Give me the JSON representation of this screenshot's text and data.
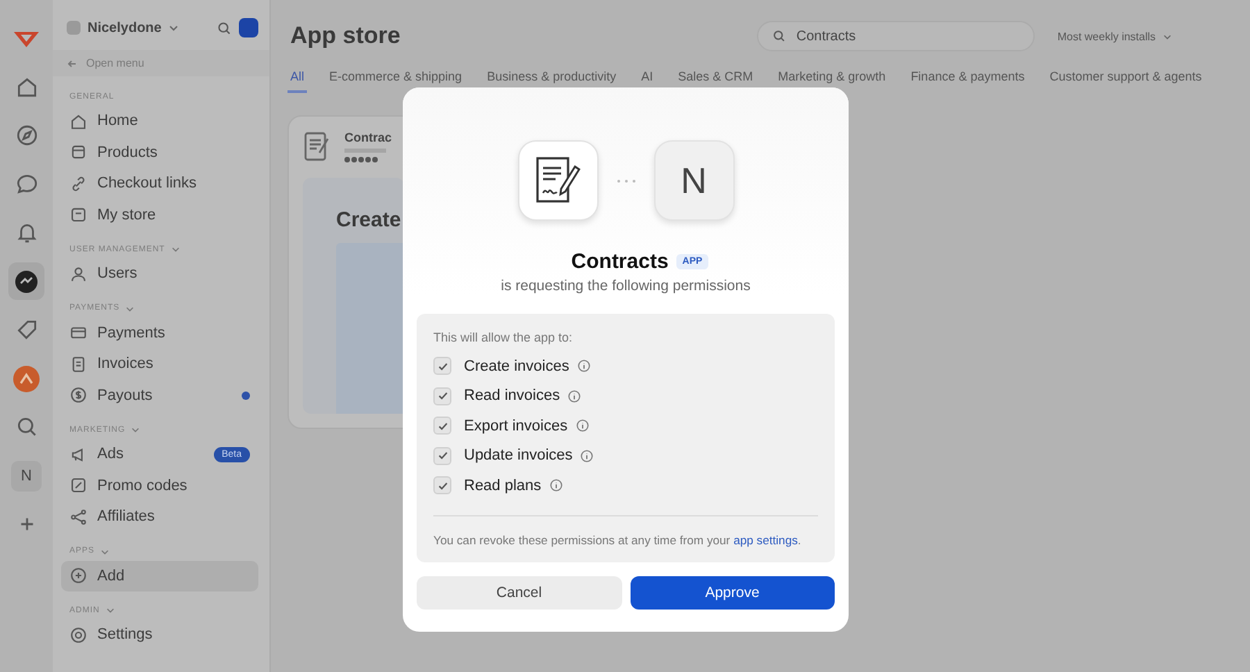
{
  "rail": {
    "items": [
      {
        "kind": "logo",
        "selected": false
      },
      {
        "kind": "home",
        "selected": false
      },
      {
        "kind": "compass",
        "selected": false
      },
      {
        "kind": "chat",
        "selected": false
      },
      {
        "kind": "bell",
        "selected": false
      },
      {
        "kind": "app",
        "selected": true
      },
      {
        "kind": "tag",
        "selected": false
      },
      {
        "kind": "orange",
        "selected": false
      },
      {
        "kind": "search",
        "selected": false
      },
      {
        "kind": "initial",
        "label": "N",
        "selected": false
      },
      {
        "kind": "add",
        "selected": false
      }
    ]
  },
  "sidebar": {
    "workspace": "Nicelydone",
    "open_menu": "Open menu",
    "sections": [
      {
        "title": "GENERAL",
        "items": [
          {
            "label": "Home",
            "kind": "home",
            "selected": false,
            "notification": false
          },
          {
            "label": "Products",
            "kind": "box",
            "selected": false,
            "notification": false
          },
          {
            "label": "Checkout links",
            "kind": "link",
            "selected": false,
            "notification": false
          },
          {
            "label": "My store",
            "kind": "store",
            "selected": false,
            "notification": false
          }
        ]
      },
      {
        "title": "USER MANAGEMENT",
        "expanded": true,
        "items": [
          {
            "label": "Users",
            "kind": "user",
            "selected": false,
            "notification": false
          }
        ]
      },
      {
        "title": "PAYMENTS",
        "expanded": true,
        "items": [
          {
            "label": "Payments",
            "kind": "card",
            "selected": false,
            "notification": false
          },
          {
            "label": "Invoices",
            "kind": "doc",
            "selected": false,
            "notification": false
          },
          {
            "label": "Payouts",
            "kind": "dollar",
            "selected": false,
            "notification": true
          }
        ]
      },
      {
        "title": "MARKETING",
        "expanded": true,
        "items": [
          {
            "label": "Ads",
            "kind": "megaphone",
            "selected": false,
            "notification": false,
            "badge": "Beta"
          },
          {
            "label": "Promo codes",
            "kind": "promo",
            "selected": false,
            "notification": false
          },
          {
            "label": "Affiliates",
            "kind": "share",
            "selected": false,
            "notification": false
          }
        ]
      },
      {
        "title": "APPS",
        "expanded": true,
        "items": [
          {
            "label": "Add",
            "kind": "plus",
            "selected": true,
            "notification": false
          }
        ]
      },
      {
        "title": "ADMIN",
        "expanded": true,
        "items": [
          {
            "label": "Settings",
            "kind": "gear",
            "selected": false,
            "notification": false
          }
        ]
      }
    ]
  },
  "main": {
    "title": "App store",
    "search": {
      "value": "Contracts"
    },
    "sort": "Most weekly installs",
    "tabs": [
      {
        "label": "All",
        "selected": true
      },
      {
        "label": "E-commerce & shipping",
        "selected": false
      },
      {
        "label": "Business & productivity",
        "selected": false
      },
      {
        "label": "AI",
        "selected": false
      },
      {
        "label": "Sales & CRM",
        "selected": false
      },
      {
        "label": "Marketing & growth",
        "selected": false
      },
      {
        "label": "Finance & payments",
        "selected": false
      },
      {
        "label": "Customer support & agents",
        "selected": false
      }
    ],
    "card": {
      "title": "Contrac",
      "stars": 5,
      "heading": "Create"
    }
  },
  "dialog": {
    "app_initial": "N",
    "title": "Contracts",
    "badge": "APP",
    "subtitle": "is requesting the following permissions",
    "intro": "This will allow the app to:",
    "permissions": [
      {
        "label": "Create invoices",
        "checked": true
      },
      {
        "label": "Read invoices",
        "checked": true
      },
      {
        "label": "Export invoices",
        "checked": true
      },
      {
        "label": "Update invoices",
        "checked": true
      },
      {
        "label": "Read plans",
        "checked": true
      }
    ],
    "note": "You can revoke these permissions at any time from your",
    "note_link": "app settings",
    "note_end": ".",
    "buttons": [
      {
        "label": "Cancel",
        "kind": "secondary"
      },
      {
        "label": "Approve",
        "kind": "primary"
      }
    ]
  }
}
